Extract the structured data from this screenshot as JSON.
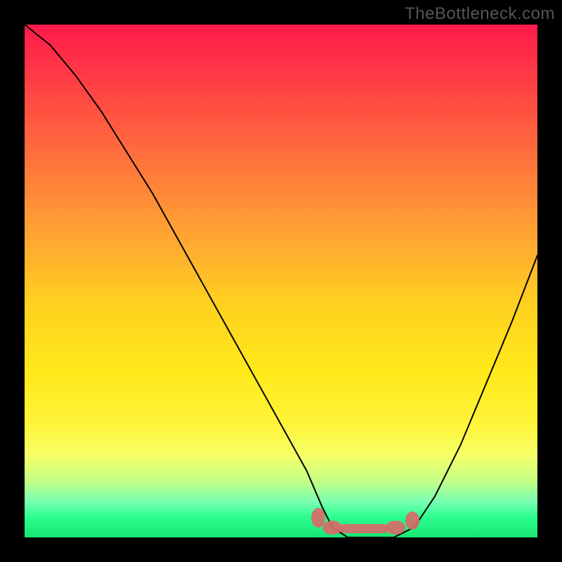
{
  "watermark": "TheBottleneck.com",
  "chart_data": {
    "type": "line",
    "title": "",
    "xlabel": "",
    "ylabel": "",
    "xlim": [
      0,
      100
    ],
    "ylim": [
      0,
      100
    ],
    "series": [
      {
        "name": "bottleneck-curve",
        "x": [
          0,
          5,
          10,
          15,
          20,
          25,
          30,
          35,
          40,
          45,
          50,
          55,
          58,
          60,
          63,
          68,
          72,
          76,
          80,
          85,
          90,
          95,
          100
        ],
        "y": [
          100,
          96,
          90,
          83,
          75,
          67,
          58,
          49,
          40,
          31,
          22,
          13,
          6,
          2,
          0,
          0,
          0,
          2,
          8,
          18,
          30,
          42,
          55
        ]
      }
    ],
    "annotations": [
      {
        "name": "optimal-zone-marker",
        "x_range": [
          56,
          77
        ],
        "y": 1
      }
    ],
    "grid": false,
    "legend": false
  },
  "colors": {
    "background": "#000000",
    "gradient_top": "#ff1a4b",
    "gradient_bottom": "#18e673",
    "curve": "#000000",
    "marker": "#d86a6a",
    "watermark": "#555555"
  }
}
